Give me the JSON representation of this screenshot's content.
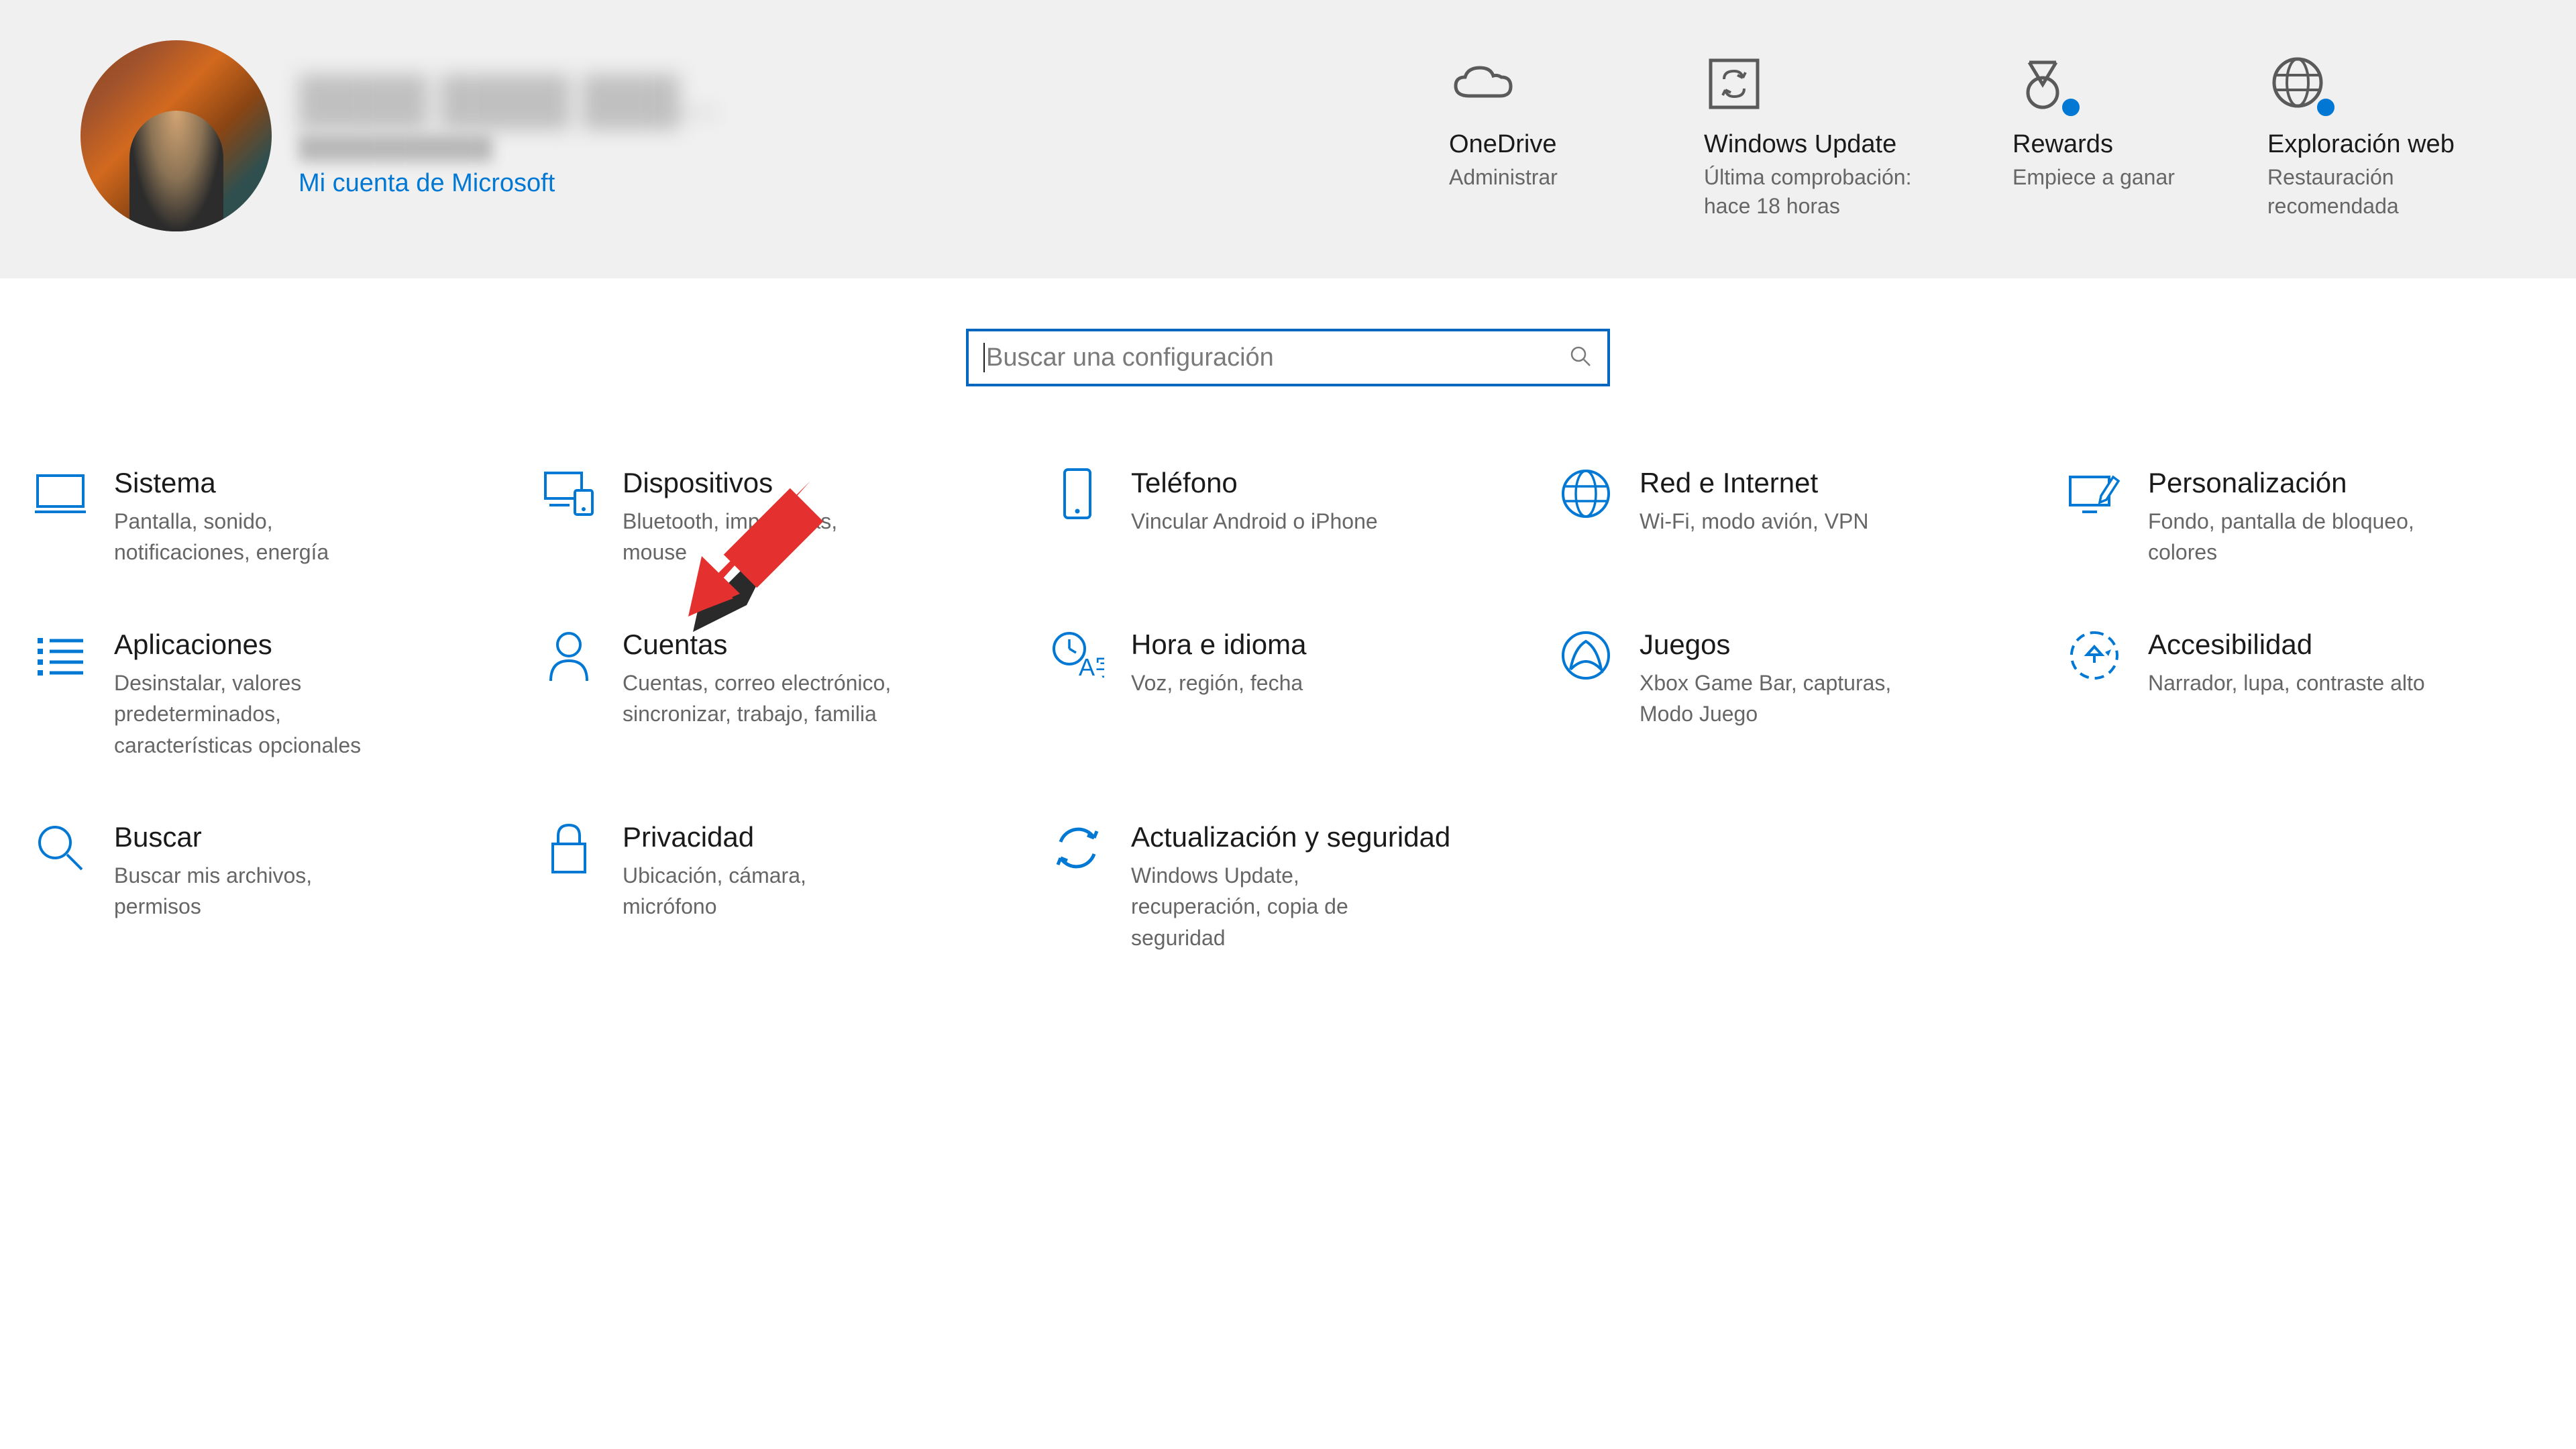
{
  "profile": {
    "name_blurred": "████ ████ ███...",
    "email_blurred": "████████████",
    "account_link": "Mi cuenta de Microsoft"
  },
  "tiles": {
    "onedrive": {
      "title": "OneDrive",
      "sub": "Administrar"
    },
    "update": {
      "title": "Windows Update",
      "sub": "Última comprobación: hace 18 horas"
    },
    "rewards": {
      "title": "Rewards",
      "sub": "Empiece a ganar"
    },
    "web": {
      "title": "Exploración web",
      "sub": "Restauración recomendada"
    }
  },
  "search": {
    "placeholder": "Buscar una configuración"
  },
  "categories": {
    "sistema": {
      "title": "Sistema",
      "desc": "Pantalla, sonido, notificaciones, energía"
    },
    "dispositivos": {
      "title": "Dispositivos",
      "desc": "Bluetooth, impresoras, mouse"
    },
    "telefono": {
      "title": "Teléfono",
      "desc": "Vincular Android o iPhone"
    },
    "red": {
      "title": "Red e Internet",
      "desc": "Wi-Fi, modo avión, VPN"
    },
    "personalizacion": {
      "title": "Personalización",
      "desc": "Fondo, pantalla de bloqueo, colores"
    },
    "aplicaciones": {
      "title": "Aplicaciones",
      "desc": "Desinstalar, valores predeterminados, características opcionales"
    },
    "cuentas": {
      "title": "Cuentas",
      "desc": "Cuentas, correo electrónico, sincronizar, trabajo, familia"
    },
    "hora": {
      "title": "Hora e idioma",
      "desc": "Voz, región, fecha"
    },
    "juegos": {
      "title": "Juegos",
      "desc": "Xbox Game Bar, capturas, Modo Juego"
    },
    "accesibilidad": {
      "title": "Accesibilidad",
      "desc": "Narrador, lupa, contraste alto"
    },
    "buscar": {
      "title": "Buscar",
      "desc": "Buscar mis archivos, permisos"
    },
    "privacidad": {
      "title": "Privacidad",
      "desc": "Ubicación, cámara, micrófono"
    },
    "actualizacion": {
      "title": "Actualización y seguridad",
      "desc": "Windows Update, recuperación, copia de seguridad"
    }
  }
}
